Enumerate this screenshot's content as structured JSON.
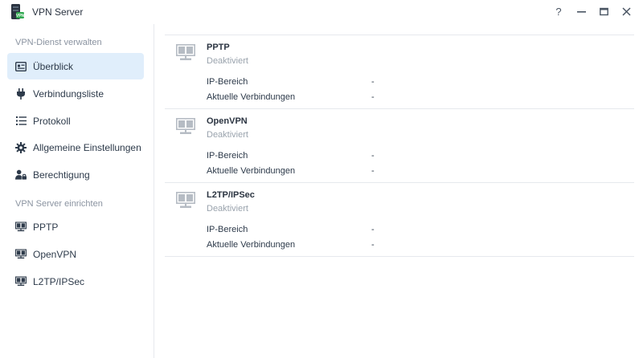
{
  "window": {
    "title": "VPN Server",
    "controls": {
      "help": "?",
      "minimize": "—",
      "maximize": "▭",
      "close": "✕"
    }
  },
  "sidebar": {
    "section_manage": "VPN-Dienst verwalten",
    "manage_items": [
      {
        "label": "Überblick",
        "icon": "overview-icon",
        "active": true
      },
      {
        "label": "Verbindungsliste",
        "icon": "plug-icon"
      },
      {
        "label": "Protokoll",
        "icon": "list-icon"
      },
      {
        "label": "Allgemeine Einstellungen",
        "icon": "gear-icon"
      },
      {
        "label": "Berechtigung",
        "icon": "user-lock-icon"
      }
    ],
    "section_setup": "VPN Server einrichten",
    "setup_items": [
      {
        "label": "PPTP",
        "icon": "server-icon"
      },
      {
        "label": "OpenVPN",
        "icon": "server-icon"
      },
      {
        "label": "L2TP/IPSec",
        "icon": "server-icon"
      }
    ]
  },
  "main": {
    "cards": [
      {
        "title": "PPTP",
        "status": "Deaktiviert",
        "ip_label": "IP-Bereich",
        "ip_value": "-",
        "conn_label": "Aktuelle Verbindungen",
        "conn_value": "-"
      },
      {
        "title": "OpenVPN",
        "status": "Deaktiviert",
        "ip_label": "IP-Bereich",
        "ip_value": "-",
        "conn_label": "Aktuelle Verbindungen",
        "conn_value": "-"
      },
      {
        "title": "L2TP/IPSec",
        "status": "Deaktiviert",
        "ip_label": "IP-Bereich",
        "ip_value": "-",
        "conn_label": "Aktuelle Verbindungen",
        "conn_value": "-"
      }
    ]
  },
  "colors": {
    "accent_bg": "#e0eefb",
    "icon_gray": "#b6bcc4",
    "app_icon_green": "#2fa84f"
  }
}
